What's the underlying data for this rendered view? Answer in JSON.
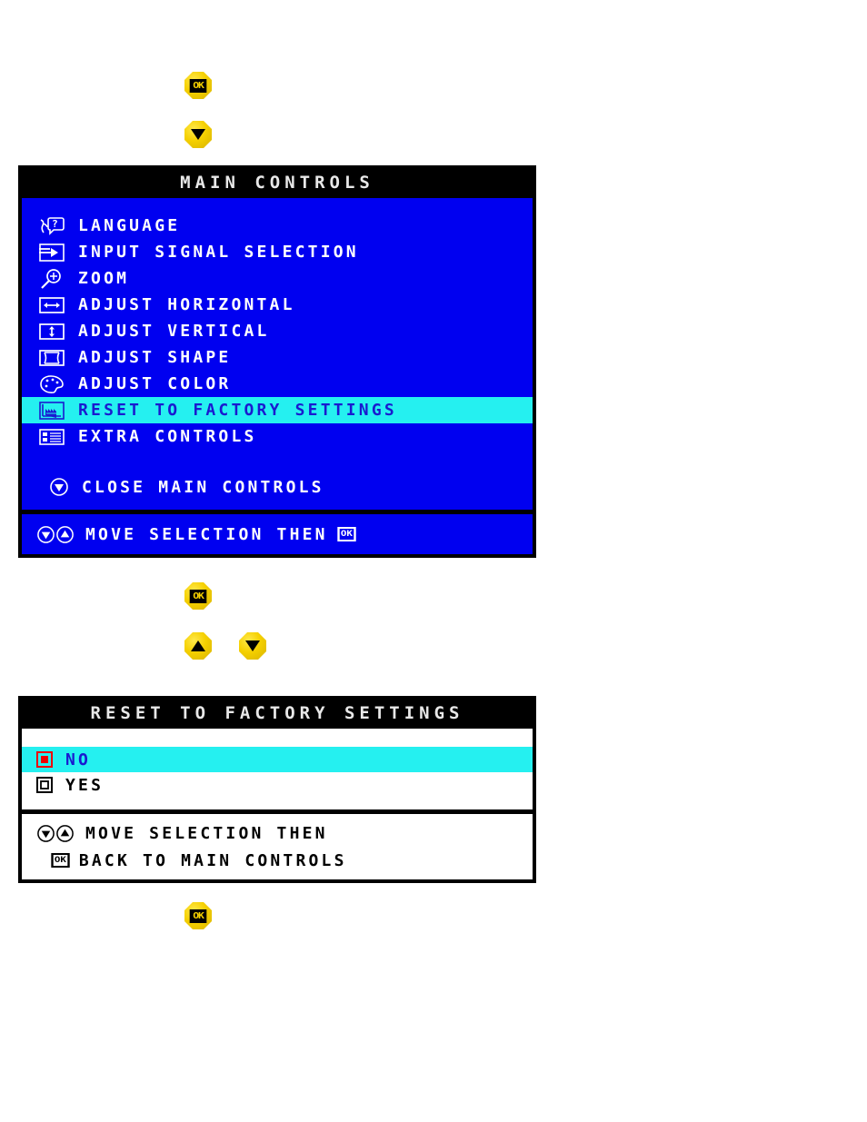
{
  "buttons": {
    "ok_top": {
      "name": "OK",
      "glyph": "ok-button-icon"
    },
    "down_top": {
      "name": "Down",
      "glyph": "arrow-down-icon"
    },
    "ok_mid": {
      "name": "OK",
      "glyph": "ok-button-icon"
    },
    "up_mid": {
      "name": "Up",
      "glyph": "arrow-up-icon"
    },
    "down_mid": {
      "name": "Down",
      "glyph": "arrow-down-icon"
    },
    "ok_bottom": {
      "name": "OK",
      "glyph": "ok-button-icon"
    },
    "ok_label": "OK"
  },
  "main_controls": {
    "title": "MAIN CONTROLS",
    "items": [
      {
        "label": "LANGUAGE",
        "icon": "language-icon",
        "selected": false
      },
      {
        "label": "INPUT SIGNAL SELECTION",
        "icon": "input-signal-icon",
        "selected": false
      },
      {
        "label": "ZOOM",
        "icon": "zoom-magnifier-icon",
        "selected": false
      },
      {
        "label": "ADJUST HORIZONTAL",
        "icon": "adjust-horizontal-icon",
        "selected": false
      },
      {
        "label": "ADJUST VERTICAL",
        "icon": "adjust-vertical-icon",
        "selected": false
      },
      {
        "label": "ADJUST SHAPE",
        "icon": "adjust-shape-icon",
        "selected": false
      },
      {
        "label": "ADJUST COLOR",
        "icon": "adjust-color-palette-icon",
        "selected": false
      },
      {
        "label": "RESET TO FACTORY SETTINGS",
        "icon": "factory-icon",
        "selected": true
      },
      {
        "label": "EXTRA CONTROLS",
        "icon": "extra-controls-list-icon",
        "selected": false
      }
    ],
    "close_label": "CLOSE MAIN CONTROLS",
    "close_icon": "arrow-down-circle-icon",
    "footer": {
      "text_before": "MOVE SELECTION THEN",
      "ok_label": "OK",
      "icons": [
        "arrow-down-circle-icon",
        "arrow-up-circle-icon"
      ]
    },
    "colors": {
      "background": "#0000f0",
      "title_bar": "#000000",
      "title_text": "#e8e8e8",
      "text": "#ffffff",
      "highlight_bg": "#25f0f0",
      "highlight_text": "#1a1ad0"
    }
  },
  "reset_dialog": {
    "title": "RESET TO FACTORY SETTINGS",
    "options": [
      {
        "label": "NO",
        "icon": "radio-filled-red-icon",
        "selected": true
      },
      {
        "label": "YES",
        "icon": "radio-empty-icon",
        "selected": false
      }
    ],
    "footer": {
      "line1": "MOVE SELECTION THEN",
      "line2": "BACK TO MAIN CONTROLS",
      "line1_icons": [
        "arrow-down-circle-icon",
        "arrow-up-circle-icon"
      ],
      "line2_icon": "ok-badge-icon",
      "ok_label": "OK"
    },
    "colors": {
      "background": "#ffffff",
      "title_bar": "#000000",
      "title_text": "#e8e8e8",
      "text": "#000000",
      "highlight_bg": "#25f0f0",
      "highlight_text": "#1a1ad0",
      "selected_marker": "#ee0000"
    }
  }
}
